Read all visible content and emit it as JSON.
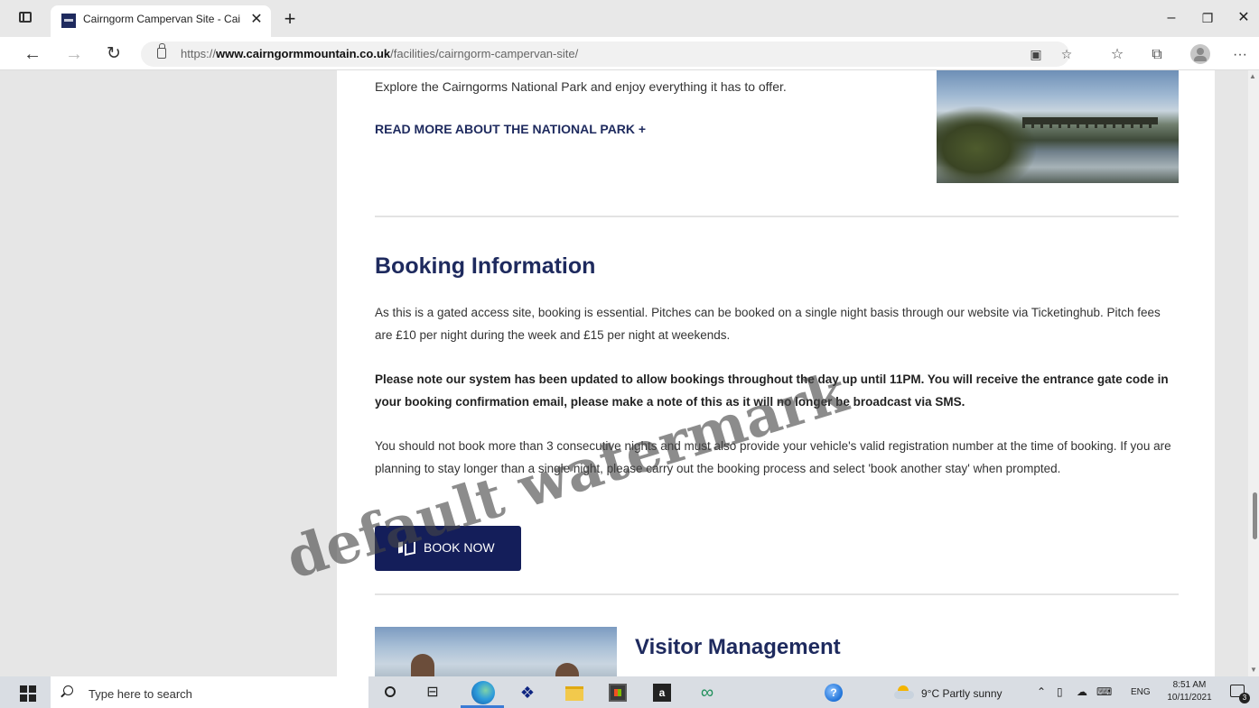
{
  "browser": {
    "tab": {
      "title": "Cairngorm Campervan Site - Cai"
    },
    "url_prefix": "https://",
    "url_domain": "www.cairngormmountain.co.uk",
    "url_path": "/facilities/cairngorm-campervan-site/"
  },
  "page": {
    "explore_text": "Explore the Cairngorms National Park and enjoy everything it has to offer.",
    "read_more": "READ MORE ABOUT THE NATIONAL PARK +",
    "booking_heading": "Booking Information",
    "booking_p1": "As this is a gated access site, booking is essential. Pitches can be booked on a single night basis through our website via Ticketinghub. Pitch fees are £10 per night during the week and £15 per night at weekends.",
    "booking_p2": "Please note our system has been updated to allow bookings throughout the day up until 11PM. You will receive the entrance gate code in your booking confirmation email, please make a note of this as it will no longer be broadcast via SMS.",
    "booking_p3": "You should not book more than 3 consecutive nights and must also provide your vehicle's valid registration number at the time of booking. If you are planning to stay longer than a single night, please carry out the booking process and select 'book another stay' when prompted.",
    "book_now": "BOOK NOW",
    "visitor_heading": "Visitor Management"
  },
  "watermark": "default watermark",
  "taskbar": {
    "search_placeholder": "Type here to search",
    "amazon_glyph": "a",
    "weather": "9°C  Partly sunny",
    "lang": "ENG",
    "time": "8:51 AM",
    "date": "10/11/2021",
    "notification_count": "3"
  },
  "colors": {
    "brand_navy": "#1e2a5e",
    "button_navy": "#141e5a",
    "page_gutter": "#e6e6e6"
  }
}
